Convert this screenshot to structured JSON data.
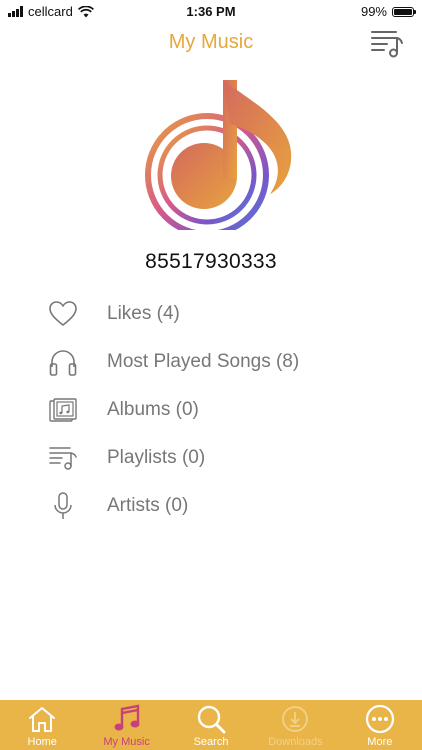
{
  "status_bar": {
    "carrier": "cellcard",
    "time": "1:36 PM",
    "battery": "99%",
    "battery_level": 0.99
  },
  "header": {
    "title": "My Music",
    "queue_icon": "playlist-music-icon"
  },
  "logo_icon": "music-note-logo-icon",
  "account": {
    "number": "85517930333"
  },
  "menu": {
    "items": [
      {
        "label": "Likes (4)",
        "icon": "heart-icon"
      },
      {
        "label": "Most Played Songs (8)",
        "icon": "headphones-icon"
      },
      {
        "label": "Albums (0)",
        "icon": "album-icon"
      },
      {
        "label": "Playlists (0)",
        "icon": "playlist-icon"
      },
      {
        "label": "Artists (0)",
        "icon": "microphone-icon"
      }
    ]
  },
  "tabs": [
    {
      "label": "Home",
      "icon": "home-icon",
      "state": "normal"
    },
    {
      "label": "My Music",
      "icon": "music-note-icon",
      "state": "active"
    },
    {
      "label": "Search",
      "icon": "search-icon",
      "state": "normal"
    },
    {
      "label": "Downloads",
      "icon": "download-icon",
      "state": "disabled"
    },
    {
      "label": "More",
      "icon": "more-icon",
      "state": "normal"
    }
  ],
  "colors": {
    "accent": "#e8a73a",
    "tab_bar": "#e9b549",
    "active_tab": "#c8417a",
    "menu_text": "#777777"
  }
}
